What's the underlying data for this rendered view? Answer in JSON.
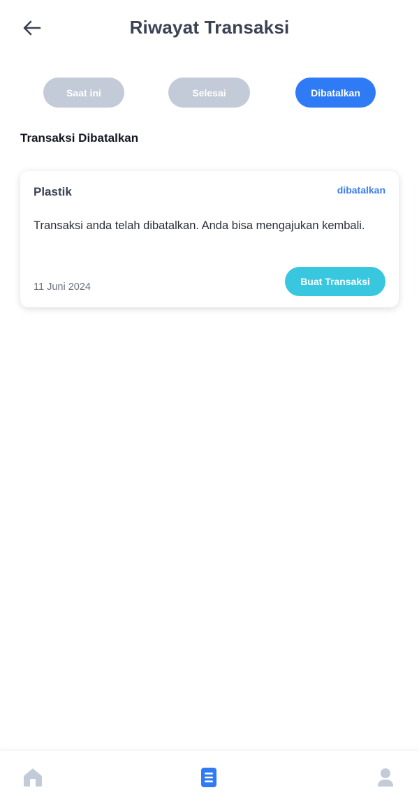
{
  "header": {
    "title": "Riwayat Transaksi",
    "back_icon": "arrow-left-icon"
  },
  "tabs": [
    {
      "label": "Saat ini",
      "active": false
    },
    {
      "label": "Selesai",
      "active": false
    },
    {
      "label": "Dibatalkan",
      "active": true
    }
  ],
  "section": {
    "title": "Transaksi Dibatalkan"
  },
  "transactions": [
    {
      "title": "Plastik",
      "status": "dibatalkan",
      "description": "Transaksi anda telah dibatalkan. Anda bisa mengajukan kembali.",
      "date": "11 Juni 2024",
      "action_label": "Buat Transaksi"
    }
  ],
  "bottom_nav": {
    "items": [
      {
        "icon": "home-icon",
        "active": false
      },
      {
        "icon": "document-list-icon",
        "active": true
      },
      {
        "icon": "user-icon",
        "active": false
      }
    ]
  },
  "colors": {
    "primary": "#2f7bf5",
    "tab_inactive": "#c3cad8",
    "action_button": "#38c7df",
    "status_text": "#3a7ef0",
    "nav_inactive": "#c3cad8",
    "nav_active": "#2f7bf5"
  }
}
